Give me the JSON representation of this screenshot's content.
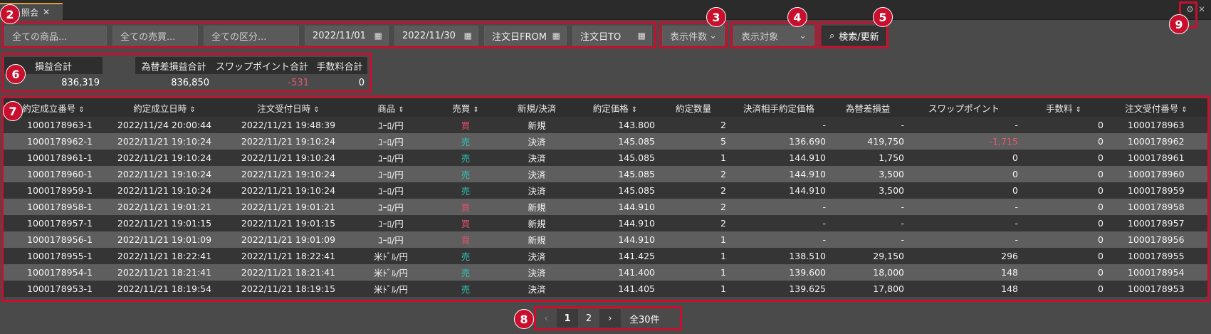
{
  "tab": {
    "title": "照会",
    "close": "✕"
  },
  "window_icons": {
    "gear": "⚙",
    "close": "✕"
  },
  "markers": [
    "2",
    "3",
    "4",
    "5",
    "6",
    "7",
    "8",
    "9"
  ],
  "filters": {
    "product_placeholder": "全ての商品...",
    "side_placeholder": "全ての売買...",
    "category_placeholder": "全ての区分...",
    "date_from": "2022/11/01",
    "date_to": "2022/11/30",
    "order_date_from_placeholder": "注文日FROM",
    "order_date_to_placeholder": "注文日TO",
    "display_count_label": "表示件数",
    "display_target_label": "表示対象",
    "search_label": "検索/更新"
  },
  "summary": {
    "pnl_total_label": "損益合計",
    "pnl_total_value": "836,319",
    "fx_pnl_label": "為替差損益合計",
    "fx_pnl_value": "836,850",
    "swap_label": "スワップポイント合計",
    "swap_value": "-531",
    "fee_label": "手数料合計",
    "fee_value": "0"
  },
  "table": {
    "headers": [
      "約定成立番号",
      "約定成立日時",
      "注文受付日時",
      "商品",
      "売買",
      "新規/決済",
      "約定価格",
      "約定数量",
      "決済相手約定価格",
      "為替差損益",
      "スワップポイント",
      "手数料",
      "注文受付番号"
    ],
    "sort_mark": "⇕",
    "rows": [
      [
        "1000178963-1",
        "2022/11/24 20:00:44",
        "2022/11/21 19:48:39",
        "ﾕｰﾛ/円",
        "買",
        "新規",
        "143.800",
        "2",
        "-",
        "-",
        "-",
        "0",
        "1000178963"
      ],
      [
        "1000178962-1",
        "2022/11/21 19:10:24",
        "2022/11/21 19:10:24",
        "ﾕｰﾛ/円",
        "売",
        "決済",
        "145.085",
        "5",
        "136.690",
        "419,750",
        "-1,715",
        "0",
        "1000178962"
      ],
      [
        "1000178961-1",
        "2022/11/21 19:10:24",
        "2022/11/21 19:10:24",
        "ﾕｰﾛ/円",
        "売",
        "決済",
        "145.085",
        "1",
        "144.910",
        "1,750",
        "0",
        "0",
        "1000178961"
      ],
      [
        "1000178960-1",
        "2022/11/21 19:10:24",
        "2022/11/21 19:10:24",
        "ﾕｰﾛ/円",
        "売",
        "決済",
        "145.085",
        "2",
        "144.910",
        "3,500",
        "0",
        "0",
        "1000178960"
      ],
      [
        "1000178959-1",
        "2022/11/21 19:10:24",
        "2022/11/21 19:10:24",
        "ﾕｰﾛ/円",
        "売",
        "決済",
        "145.085",
        "2",
        "144.910",
        "3,500",
        "0",
        "0",
        "1000178959"
      ],
      [
        "1000178958-1",
        "2022/11/21 19:01:21",
        "2022/11/21 19:01:21",
        "ﾕｰﾛ/円",
        "買",
        "新規",
        "144.910",
        "2",
        "-",
        "-",
        "-",
        "0",
        "1000178958"
      ],
      [
        "1000178957-1",
        "2022/11/21 19:01:15",
        "2022/11/21 19:01:15",
        "ﾕｰﾛ/円",
        "買",
        "新規",
        "144.910",
        "2",
        "-",
        "-",
        "-",
        "0",
        "1000178957"
      ],
      [
        "1000178956-1",
        "2022/11/21 19:01:09",
        "2022/11/21 19:01:09",
        "ﾕｰﾛ/円",
        "買",
        "新規",
        "144.910",
        "1",
        "-",
        "-",
        "-",
        "0",
        "1000178956"
      ],
      [
        "1000178955-1",
        "2022/11/21 18:22:41",
        "2022/11/21 18:22:41",
        "米ﾄﾞﾙ/円",
        "売",
        "決済",
        "141.425",
        "1",
        "138.510",
        "29,150",
        "296",
        "0",
        "1000178955"
      ],
      [
        "1000178954-1",
        "2022/11/21 18:21:41",
        "2022/11/21 18:21:41",
        "米ﾄﾞﾙ/円",
        "売",
        "決済",
        "141.400",
        "1",
        "139.600",
        "18,000",
        "148",
        "0",
        "1000178954"
      ],
      [
        "1000178953-1",
        "2022/11/21 18:19:54",
        "2022/11/21 18:19:15",
        "米ﾄﾞﾙ/円",
        "売",
        "決済",
        "141.405",
        "1",
        "139.625",
        "17,800",
        "148",
        "0",
        "1000178953"
      ]
    ]
  },
  "pager": {
    "prev": "‹",
    "pages": [
      "1",
      "2"
    ],
    "next": "›",
    "total": "全30件"
  },
  "colors": {
    "buy": "#e0506a",
    "sell": "#2fc2b0",
    "negative": "#e05a6a",
    "highlight": "#c8102e"
  }
}
